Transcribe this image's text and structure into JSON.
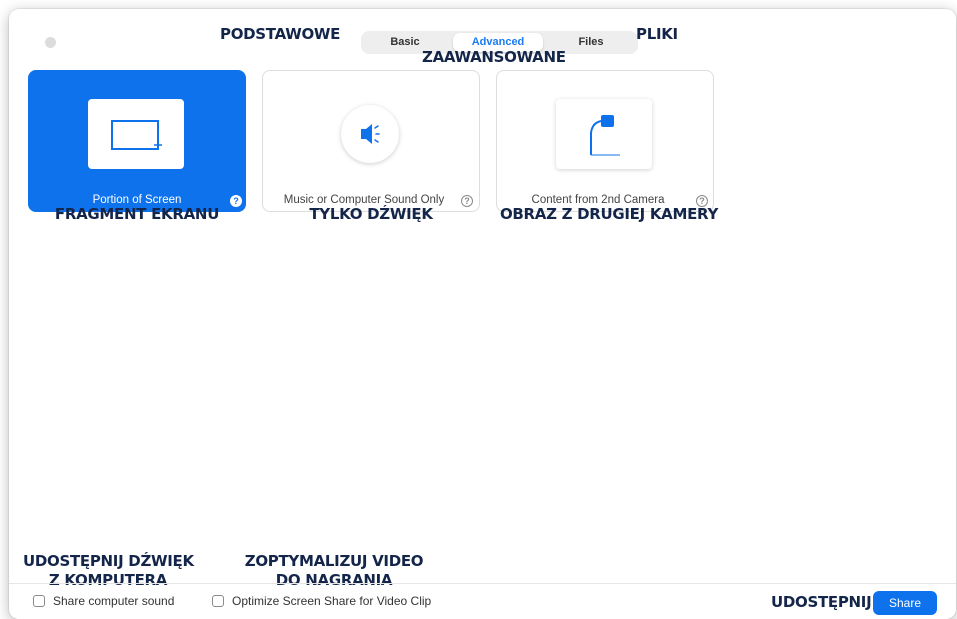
{
  "tabs": [
    {
      "label": "Basic"
    },
    {
      "label": "Advanced",
      "active": true
    },
    {
      "label": "Files"
    }
  ],
  "annotations": {
    "basic": "PODSTAWOWE",
    "advanced": "ZAAWANSOWANE",
    "files": "PLIKI",
    "portion": "FRAGMENT EKRANU",
    "sound_only": "TYLKO DŹWIĘK",
    "second_camera": "OBRAZ Z DRUGIEJ KAMERY",
    "share_sound_line1": "UDOSTĘPNIJ DŹWIĘK",
    "share_sound_line2": "Z KOMPUTERA",
    "optimize_line1": "ZOPTYMALIZUJ VIDEO",
    "optimize_line2": "DO NAGRANIA",
    "share": "UDOSTĘPNIJ"
  },
  "cards": [
    {
      "label": "Portion of Screen",
      "icon": "screen-portion-icon",
      "selected": true
    },
    {
      "label": "Music or Computer Sound Only",
      "icon": "speaker-icon",
      "selected": false
    },
    {
      "label": "Content from 2nd Camera",
      "icon": "document-camera-icon",
      "selected": false
    }
  ],
  "bottom": {
    "share_sound_label": "Share computer sound",
    "optimize_label": "Optimize Screen Share for Video Clip",
    "share_button": "Share"
  },
  "colors": {
    "accent": "#0e72ed",
    "annotation": "#14254a"
  }
}
